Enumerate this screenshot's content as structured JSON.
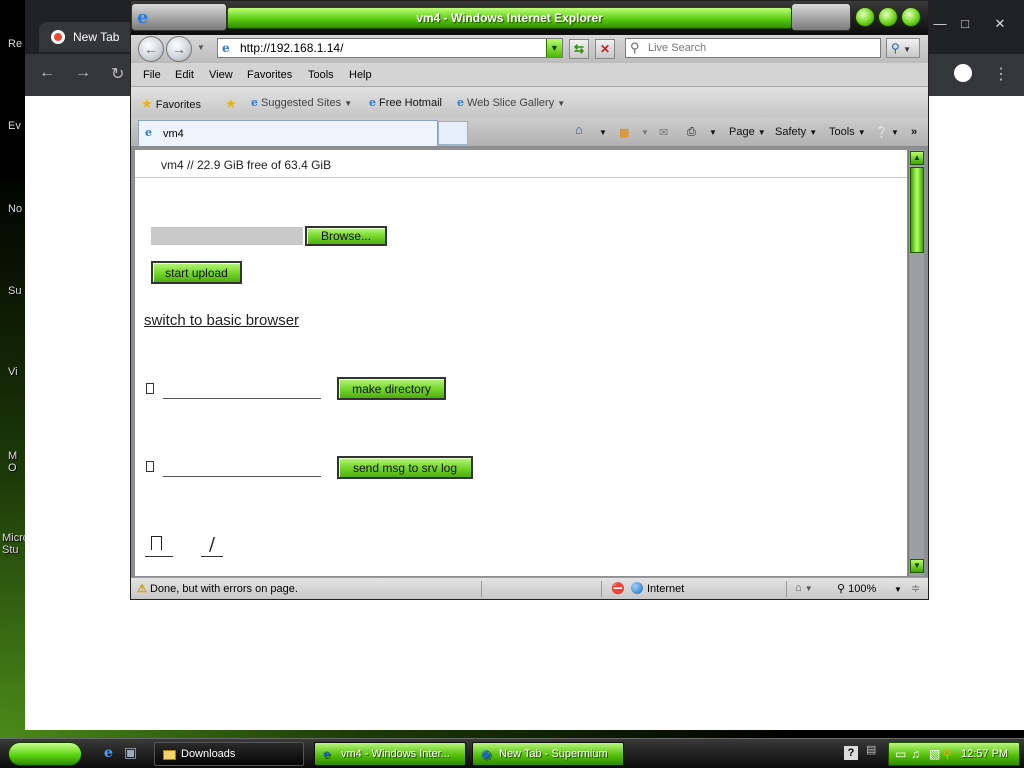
{
  "desktop": {
    "labels": [
      "Re",
      "Ev",
      "No",
      "Su",
      "Vi",
      "M\nO",
      "Micro\nStu"
    ]
  },
  "chrome": {
    "tab_title": "New Tab"
  },
  "ie": {
    "window_title": "vm4 - Windows Internet Explorer",
    "address": "http://192.168.1.14/",
    "search_placeholder": "Live Search",
    "menu": [
      "File",
      "Edit",
      "View",
      "Favorites",
      "Tools",
      "Help"
    ],
    "favorites_label": "Favorites",
    "favorites_links": [
      "Suggested Sites",
      "Free Hotmail",
      "Web Slice Gallery"
    ],
    "tab_title": "vm4",
    "command_bar": {
      "page": "Page",
      "safety": "Safety",
      "tools": "Tools",
      "more": "»"
    },
    "status": {
      "message": "Done, but with errors on page.",
      "zone": "Internet",
      "zoom": "100%"
    }
  },
  "page": {
    "header": "vm4 // 22.9 GiB free of 63.4 GiB",
    "browse_label": "Browse...",
    "start_upload_label": "start upload",
    "switch_link": "switch to basic browser",
    "make_directory_label": "make directory",
    "send_msg_label": "send msg to srv log",
    "slash_glyph": "/"
  },
  "taskbar": {
    "tasks": [
      "Downloads",
      "vm4 - Windows Inter...",
      "New Tab - Supermium"
    ],
    "clock": "12:57 PM"
  },
  "colors": {
    "accent_green": "#5ccc10",
    "header_rule": "#f2c84b"
  }
}
